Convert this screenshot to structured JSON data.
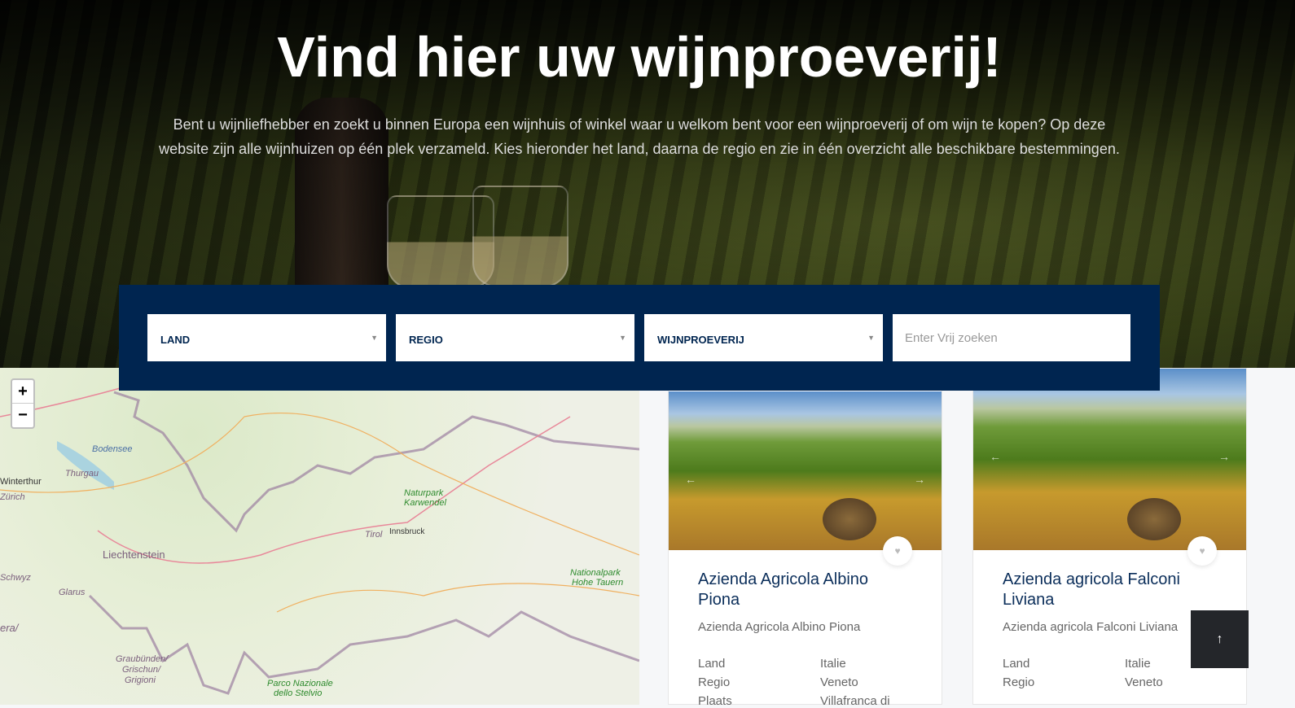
{
  "hero": {
    "title": "Vind hier uw wijnproeverij!",
    "intro": "Bent u wijnliefhebber en zoekt u binnen Europa een wijnhuis of winkel waar u welkom bent voor een wijnproeverij of om wijn te kopen? Op deze website zijn alle wijnhuizen op één plek verzameld. Kies hieronder het land, daarna de regio en zie in één overzicht alle beschikbare bestemmingen."
  },
  "search": {
    "land": "LAND",
    "regio": "REGIO",
    "wijnproeverij": "WIJNPROEVERIJ",
    "free_placeholder": "Enter Vrij zoeken"
  },
  "map": {
    "zoom_in": "+",
    "zoom_out": "−",
    "labels": {
      "bodensee": "Bodensee",
      "thurgau": "Thurgau",
      "winterthur": "Winterthur",
      "zurich": "Zürich",
      "liechtenstein": "Liechtenstein",
      "schwyz": "Schwyz",
      "glarus": "Glarus",
      "karwendel1": "Naturpark",
      "karwendel2": "Karwendel",
      "tirol": "Tirol",
      "innsbruck": "Innsbruck",
      "tauern1": "Nationalpark",
      "tauern2": "Hohe Tauern",
      "graub1": "Graubünden/",
      "graub2": "Grischun/",
      "graub3": "Grigioni",
      "stelvio1": "Parco Nazionale",
      "stelvio2": "dello Stelvio",
      "era": "era/"
    }
  },
  "cards": [
    {
      "title": "Azienda Agricola Albino Piona",
      "subtitle": "Azienda Agricola Albino Piona",
      "rows": [
        [
          "Land",
          "Italie"
        ],
        [
          "Regio",
          "Veneto"
        ],
        [
          "Plaats",
          "Villafranca di"
        ]
      ]
    },
    {
      "title": "Azienda agricola Falconi Liviana",
      "subtitle": "Azienda agricola Falconi Liviana",
      "rows": [
        [
          "Land",
          "Italie"
        ],
        [
          "Regio",
          "Veneto"
        ]
      ]
    }
  ],
  "back_to_top": "↑",
  "icons": {
    "heart": "♥",
    "prev": "←",
    "next": "→",
    "caret": "▼"
  }
}
